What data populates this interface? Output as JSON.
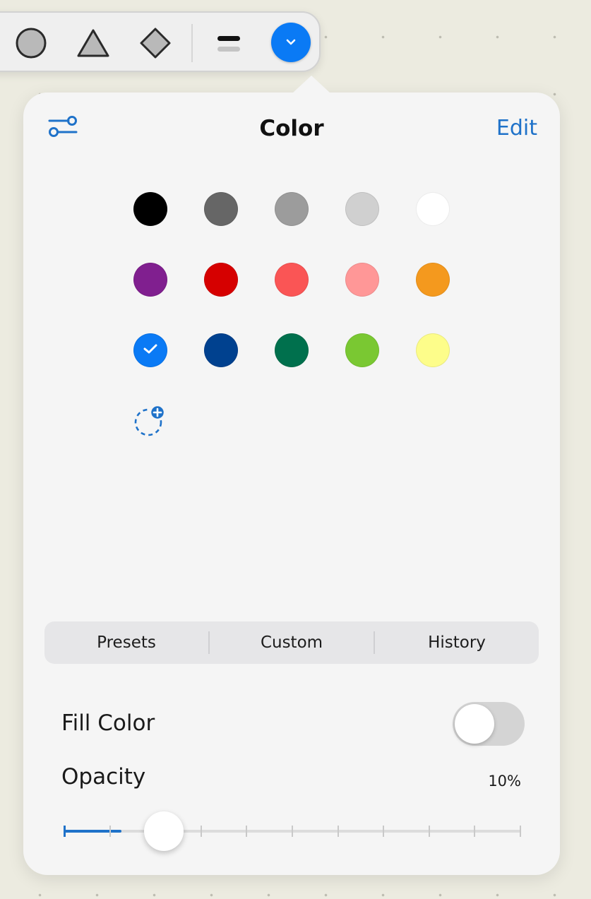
{
  "toolbar": {
    "tools": [
      {
        "name": "circle-shape-icon"
      },
      {
        "name": "triangle-shape-icon"
      },
      {
        "name": "diamond-shape-icon"
      },
      {
        "name": "line-style-icon"
      }
    ],
    "color_button": {
      "icon": "chevron-down-icon",
      "color": "#0a7af5"
    }
  },
  "popover": {
    "title": "Color",
    "edit_label": "Edit",
    "settings_icon": "sliders-icon",
    "accent_color": "#1f72c9",
    "swatches": [
      {
        "color": "#000000"
      },
      {
        "color": "#666666"
      },
      {
        "color": "#9c9c9c"
      },
      {
        "color": "#d0d0d0"
      },
      {
        "color": "#ffffff"
      },
      {
        "color": "#801f8f"
      },
      {
        "color": "#d60000"
      },
      {
        "color": "#fa5555"
      },
      {
        "color": "#ff9797"
      },
      {
        "color": "#f4991e"
      },
      {
        "color": "#0a7af5",
        "selected": true
      },
      {
        "color": "#00418f"
      },
      {
        "color": "#00704d"
      },
      {
        "color": "#7ac832"
      },
      {
        "color": "#fdfd8a"
      }
    ],
    "add_swatch_icon": "add-color-icon",
    "tabs": [
      {
        "label": "Presets"
      },
      {
        "label": "Custom"
      },
      {
        "label": "History"
      }
    ],
    "fill_color": {
      "label": "Fill Color",
      "enabled": false
    },
    "opacity": {
      "label": "Opacity",
      "value_text": "10%",
      "value": 0.1,
      "ticks": 11
    }
  }
}
